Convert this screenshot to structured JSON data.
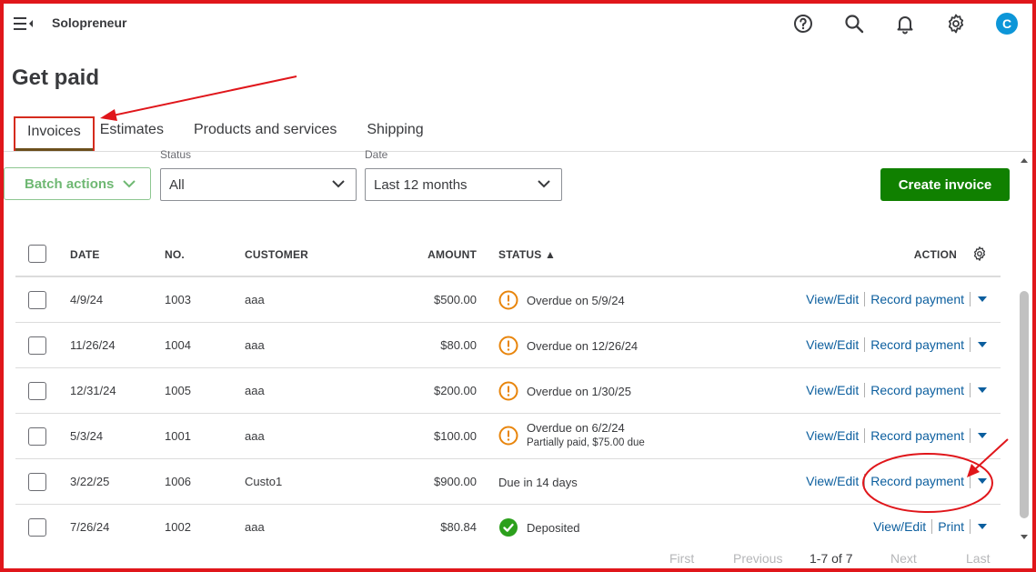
{
  "header": {
    "company_name": "Solopreneur",
    "avatar_letter": "C"
  },
  "page": {
    "title": "Get paid"
  },
  "tabs": [
    {
      "label": "Invoices"
    },
    {
      "label": "Estimates"
    },
    {
      "label": "Products and services"
    },
    {
      "label": "Shipping"
    }
  ],
  "filters": {
    "batch_label": "Batch actions",
    "status_label": "Status",
    "status_value": "All",
    "date_label": "Date",
    "date_value": "Last 12 months",
    "create_label": "Create invoice"
  },
  "table": {
    "columns": {
      "date": "DATE",
      "no": "NO.",
      "customer": "CUSTOMER",
      "amount": "AMOUNT",
      "status": "STATUS ▲",
      "action": "ACTION"
    },
    "rows": [
      {
        "date": "4/9/24",
        "no": "1003",
        "customer": "aaa",
        "amount": "$500.00",
        "status": "Overdue on 5/9/24",
        "substatus": "",
        "status_type": "overdue",
        "action1": "View/Edit",
        "action2": "Record payment"
      },
      {
        "date": "11/26/24",
        "no": "1004",
        "customer": "aaa",
        "amount": "$80.00",
        "status": "Overdue on 12/26/24",
        "substatus": "",
        "status_type": "overdue",
        "action1": "View/Edit",
        "action2": "Record payment"
      },
      {
        "date": "12/31/24",
        "no": "1005",
        "customer": "aaa",
        "amount": "$200.00",
        "status": "Overdue on 1/30/25",
        "substatus": "",
        "status_type": "overdue",
        "action1": "View/Edit",
        "action2": "Record payment"
      },
      {
        "date": "5/3/24",
        "no": "1001",
        "customer": "aaa",
        "amount": "$100.00",
        "status": "Overdue on 6/2/24",
        "substatus": "Partially paid, $75.00 due",
        "status_type": "overdue",
        "action1": "View/Edit",
        "action2": "Record payment"
      },
      {
        "date": "3/22/25",
        "no": "1006",
        "customer": "Custo1",
        "amount": "$900.00",
        "status": "Due in 14 days",
        "substatus": "",
        "status_type": "due",
        "action1": "View/Edit",
        "action2": "Record payment"
      },
      {
        "date": "7/26/24",
        "no": "1002",
        "customer": "aaa",
        "amount": "$80.84",
        "status": "Deposited",
        "substatus": "",
        "status_type": "deposited",
        "action1": "View/Edit",
        "action2": "Print"
      }
    ]
  },
  "pagination": {
    "first": "First",
    "previous": "Previous",
    "range": "1-7 of 7",
    "next": "Next",
    "last": "Last"
  },
  "colors": {
    "brand_green": "#108000",
    "link_blue": "#0b5e9e",
    "overdue_orange": "#e8850c",
    "deposited_green": "#2ca01c",
    "annotation_red": "#e0161b"
  }
}
